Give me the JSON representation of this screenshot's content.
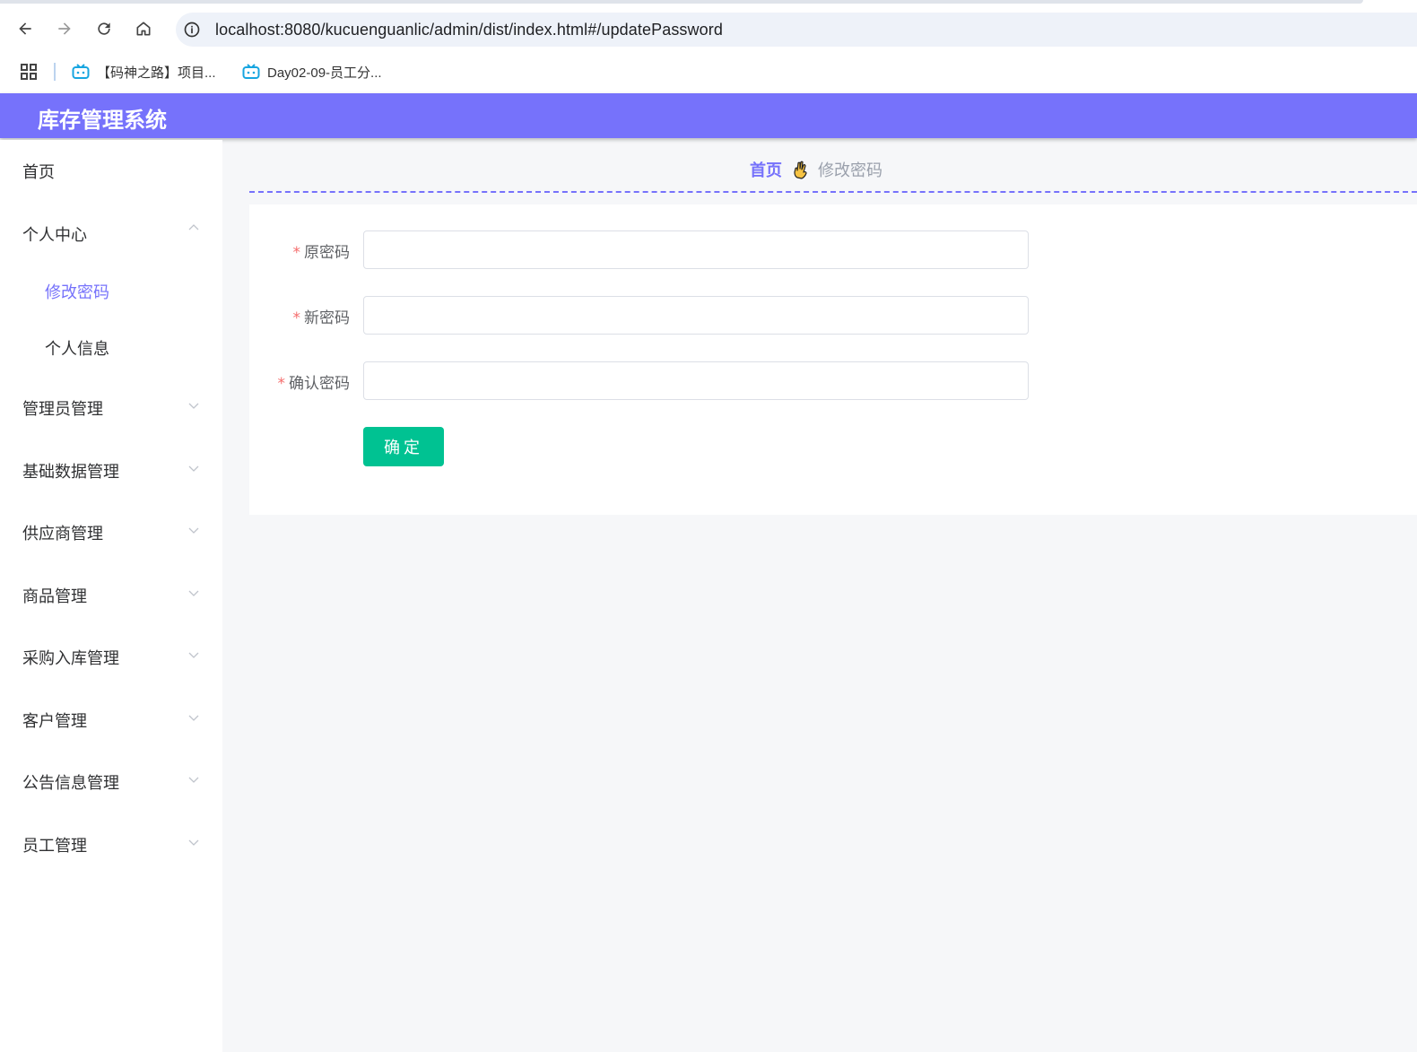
{
  "browser": {
    "url": "localhost:8080/kucuenguanlic/admin/dist/index.html#/updatePassword",
    "bookmarks": [
      {
        "label": "【码神之路】项目..."
      },
      {
        "label": "Day02-09-员工分..."
      }
    ]
  },
  "app": {
    "title": "库存管理系统",
    "accent_color": "#7672fb"
  },
  "sidebar": {
    "items": [
      {
        "label": "首页"
      },
      {
        "label": "个人中心",
        "expanded": true,
        "children": [
          {
            "label": "修改密码",
            "active": true
          },
          {
            "label": "个人信息"
          }
        ]
      },
      {
        "label": "管理员管理"
      },
      {
        "label": "基础数据管理"
      },
      {
        "label": "供应商管理"
      },
      {
        "label": "商品管理"
      },
      {
        "label": "采购入库管理"
      },
      {
        "label": "客户管理"
      },
      {
        "label": "公告信息管理"
      },
      {
        "label": "员工管理"
      }
    ]
  },
  "breadcrumb": {
    "home": "首页",
    "current": "修改密码"
  },
  "form": {
    "required_mark": "*",
    "fields": [
      {
        "label": "原密码",
        "value": ""
      },
      {
        "label": "新密码",
        "value": ""
      },
      {
        "label": "确认密码",
        "value": ""
      }
    ],
    "submit_label": "确定",
    "submit_color": "#00c292"
  }
}
